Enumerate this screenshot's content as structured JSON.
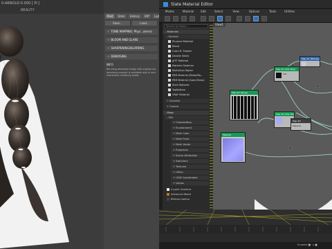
{
  "viewport": {
    "caption": "0-ARNOLD-0.000 [ PI ]",
    "label": "BEAUTY"
  },
  "panel": {
    "tabs": [
      "Post",
      "Stats",
      "History",
      "Diff",
      "Light mixer"
    ],
    "buttons": [
      "Save...",
      "Load..."
    ],
    "rollouts": [
      {
        "arrow": "+",
        "label": "TONE MAPPING: Phys...amera"
      },
      {
        "arrow": "+",
        "label": "BLOOM AND GLARE"
      },
      {
        "arrow": "+",
        "label": "SHARPENING/BLURRING"
      },
      {
        "arrow": "+",
        "label": "DENOISING"
      }
    ],
    "info_title": "INFO",
    "info_body": "Blending denoised image with original via denoising amount is available only in non-interactive rendering mode."
  },
  "slate": {
    "title": "Slate Material Editor",
    "menus": [
      "Modes",
      "Material",
      "Edit",
      "Select",
      "View",
      "Options",
      "Tools",
      "Utilities"
    ],
    "search_placeholder": "Search by Name ...",
    "view_tab": "View1",
    "materials_header": "- Materials",
    "general_header": "- General",
    "materials": [
      "Physical Material",
      "Blend",
      "Crom.R. Shader",
      "Double Sided",
      "gITF Material",
      "Material Switcher",
      "Multi/Sub-Object",
      "PBR Material (Metal/Ro...",
      "PBR Material (Spec/Gloss)",
      "Shell Material",
      "TopBottom",
      "VRaF Material"
    ],
    "collapsed_groups": [
      "+ Scanline",
      "+ Corona"
    ],
    "maps_header": "- Maps",
    "osl_header": "- OSL",
    "map_groups": [
      "+ Compositing",
      "+ Environment",
      "+ Math Color",
      "+ Math Float",
      "+ Math Vector",
      "+ Projection",
      "+ Scene Attribution",
      "+ Switchers",
      "+ Textures",
      "+ Utility",
      "+ UVW Coordinates",
      "+ Values"
    ],
    "special_maps": [
      {
        "label": "4 point Gradient",
        "color": "#e8e8e8"
      },
      {
        "label": "Advanced Wood",
        "color": "#b5722e"
      },
      {
        "label": "Bitmap Lookup",
        "color": "#444"
      }
    ],
    "render_button": "Rendering Enabled",
    "nodes": {
      "n1_title": "Map #3 (OSL Map)",
      "n1_sub": "OSL",
      "n2_title": "Map #1 (Bitmap)",
      "n3_title": "Map #2 (Noise)",
      "n3_sub": "Material",
      "n4_title": "Map #5 (OSL Map)",
      "n5_title": "Map #4",
      "n6_title": "Material"
    }
  },
  "status": {
    "text": "Enabled  ■  ·  ▸  ■"
  },
  "colors": {
    "accent_blue": "#3a8dd6",
    "node_green": "#169b55",
    "wire": "#a8e0d6",
    "timeline_yellow": "#c9c937"
  }
}
